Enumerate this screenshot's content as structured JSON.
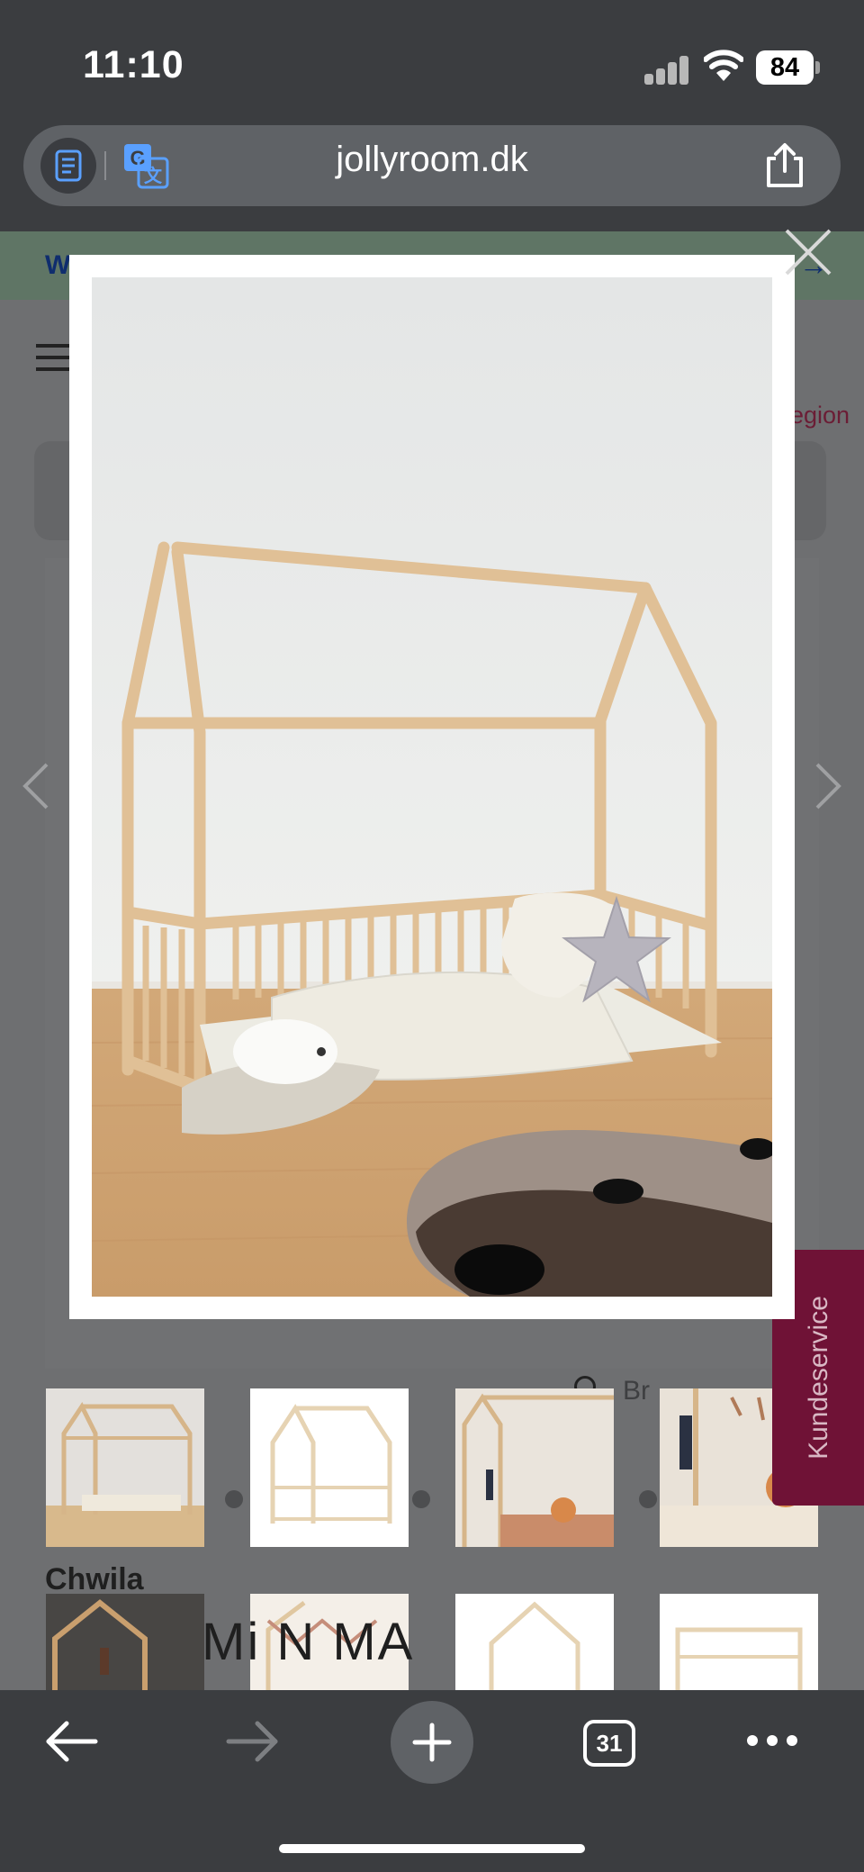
{
  "status_bar": {
    "time": "11:10",
    "battery": "84"
  },
  "browser": {
    "domain": "jollyroom.dk",
    "tab_count": "31"
  },
  "page": {
    "banner_text": "W",
    "banner_arrow": "→",
    "region_label": "egion",
    "brand_search_text": "Br",
    "kundeservice": "Kundeservice",
    "product_brand": "Chwila",
    "product_title_partial": "Mi     N     MA"
  },
  "colors": {
    "kundeservice_bg": "#6f1236",
    "banner_bg": "#5f7565",
    "toolbar_bg": "#3b3d40"
  },
  "lightbox": {
    "image_description": "wooden house-frame floor bed"
  },
  "thumbnails": {
    "row1": [
      "house-bed-front",
      "house-bed-white",
      "house-bed-bunting",
      "house-bed-toys"
    ],
    "row2": [
      "house-bed-dark",
      "house-bed-garland",
      "house-bed-outline",
      "house-bed-frame"
    ]
  }
}
